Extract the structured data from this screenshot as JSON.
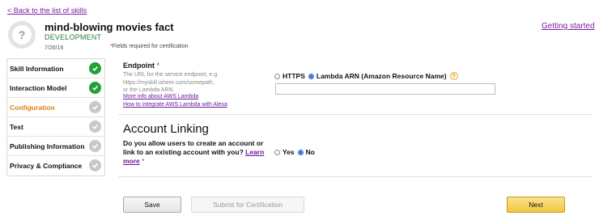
{
  "header": {
    "back_link": "< Back to the list of skills",
    "getting_started": "Getting started",
    "skill_name": "mind-blowing movies fact",
    "skill_status": "DEVELOPMENT",
    "date": "7/26/16",
    "fields_note": "Fields required for certification",
    "icon_glyph": "?"
  },
  "nav": {
    "items": [
      {
        "label": "Skill Information",
        "status": "done"
      },
      {
        "label": "Interaction Model",
        "status": "done"
      },
      {
        "label": "Configuration",
        "status": "todo",
        "active": true
      },
      {
        "label": "Test",
        "status": "todo"
      },
      {
        "label": "Publishing Information",
        "status": "todo"
      },
      {
        "label": "Privacy & Compliance",
        "status": "todo"
      }
    ]
  },
  "endpoint": {
    "label": "Endpoint",
    "description_lines": [
      "The URL for the service endpoint, e.g.",
      "https://myskill.ishere.com/somepath,",
      "or the Lambda ARN."
    ],
    "link_lambda": "More info about AWS Lambda",
    "link_integrate": "How to integrate AWS Lambda with Alexa",
    "option_https": "HTTPS",
    "option_lambda": "Lambda ARN (Amazon Resource Name)",
    "selected": "lambda",
    "arn_value": ""
  },
  "account_linking": {
    "title": "Account Linking",
    "question": "Do you allow users to create an account or link to an existing account with you?",
    "learn_more": "Learn more",
    "option_yes": "Yes",
    "option_no": "No",
    "selected": "no"
  },
  "buttons": {
    "save": "Save",
    "submit": "Submit for Certification",
    "next": "Next"
  },
  "colors": {
    "active_nav": "#e07f16",
    "done_badge": "#23a035",
    "todo_badge": "#c8c8c8",
    "link": "#6a1b9a",
    "next_button": "#f1c642"
  }
}
